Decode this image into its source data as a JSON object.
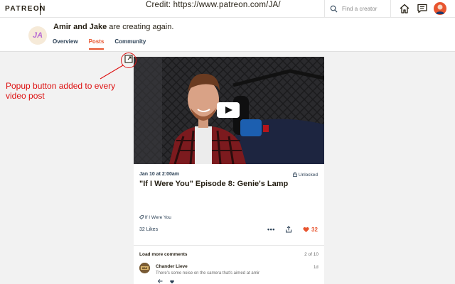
{
  "topbar": {
    "logo": "PATREON",
    "credit": "Credit: https://www.patreon.com/JA/",
    "search_placeholder": "Find a creator"
  },
  "creator": {
    "avatar_initials": "JA",
    "name": "Amir and Jake",
    "tagline": " are creating again.",
    "tabs": [
      {
        "label": "Overview",
        "active": false
      },
      {
        "label": "Posts",
        "active": true
      },
      {
        "label": "Community",
        "active": false
      }
    ]
  },
  "post": {
    "date": "Jan 10 at 2:00am",
    "lock_status": "Unlocked",
    "title": "\"If I Were You\" Episode 8: Genie's Lamp",
    "tag": "If I Were You",
    "likes": "32 Likes",
    "more": "•••",
    "like_count": "32"
  },
  "comments": {
    "load_more": "Load more comments",
    "count": "2 of 10",
    "items": [
      {
        "author": "Chander Lieve",
        "text": "There's some noise on the camera that's aimed at amir",
        "time": "1d"
      }
    ]
  },
  "annotation": {
    "text": "Popup button added to every video post"
  },
  "colors": {
    "accent": "#e8552f",
    "annotation": "#dd1111",
    "nav_text": "#2c4156"
  }
}
